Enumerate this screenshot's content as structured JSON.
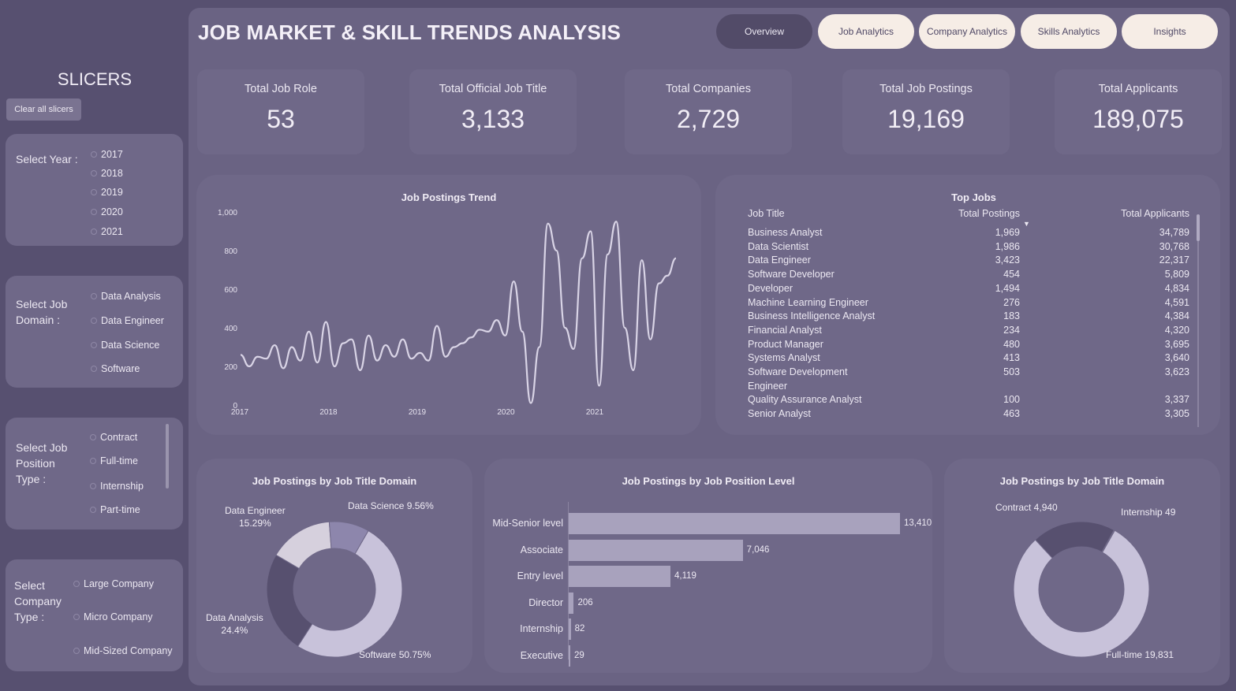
{
  "sidebar": {
    "title": "SLICERS",
    "clear_label": "Clear all slicers",
    "year": {
      "label": "Select Year :",
      "options": [
        "2017",
        "2018",
        "2019",
        "2020",
        "2021"
      ]
    },
    "domain": {
      "label": "Select Job Domain :",
      "options": [
        "Data Analysis",
        "Data Engineer",
        "Data Science",
        "Software"
      ]
    },
    "position": {
      "label": "Select Job Position Type :",
      "options": [
        "Contract",
        "Full-time",
        "Internship",
        "Part-time"
      ]
    },
    "company": {
      "label": "Select Company Type :",
      "options": [
        "Large Company",
        "Micro Company",
        "Mid-Sized Company"
      ]
    }
  },
  "header": {
    "title": "JOB MARKET & SKILL TRENDS ANALYSIS",
    "nav": [
      "Overview",
      "Job Analytics",
      "Company Analytics",
      "Skills Analytics",
      "Insights"
    ],
    "active": "Overview"
  },
  "kpis": [
    {
      "label": "Total Job Role",
      "value": "53"
    },
    {
      "label": "Total Official Job Title",
      "value": "3,133"
    },
    {
      "label": "Total Companies",
      "value": "2,729"
    },
    {
      "label": "Total Job Postings",
      "value": "19,169"
    },
    {
      "label": "Total Applicants",
      "value": "189,075"
    }
  ],
  "top_jobs": {
    "title": "Top Jobs",
    "headers": [
      "Job Title",
      "Total Postings",
      "Total Applicants"
    ],
    "rows": [
      [
        "Business Analyst",
        "1,969",
        "34,789"
      ],
      [
        "Data Scientist",
        "1,986",
        "30,768"
      ],
      [
        "Data Engineer",
        "3,423",
        "22,317"
      ],
      [
        "Software Developer",
        "454",
        "5,809"
      ],
      [
        "Developer",
        "1,494",
        "4,834"
      ],
      [
        "Machine Learning Engineer",
        "276",
        "4,591"
      ],
      [
        "Business Intelligence Analyst",
        "183",
        "4,384"
      ],
      [
        "Financial Analyst",
        "234",
        "4,320"
      ],
      [
        "Product Manager",
        "480",
        "3,695"
      ],
      [
        "Systems Analyst",
        "413",
        "3,640"
      ],
      [
        "Software Development",
        "503",
        "3,623"
      ],
      [
        "Engineer",
        "",
        ""
      ],
      [
        "Quality Assurance Analyst",
        "100",
        "3,337"
      ],
      [
        "Senior Analyst",
        "463",
        "3,305"
      ]
    ]
  },
  "colors": {
    "accent": "#c5bfd7",
    "bar": "#a8a2bd",
    "dark": "#524b68"
  },
  "chart_data": [
    {
      "type": "line",
      "title": "Job Postings Trend",
      "ylim": [
        0,
        1000
      ],
      "yticks": [
        "1,000",
        "800",
        "600",
        "400",
        "200",
        "0"
      ],
      "xticks": [
        "2017",
        "2018",
        "2019",
        "2020",
        "2021"
      ],
      "x": [
        0,
        1,
        2,
        3,
        4,
        5,
        6,
        7,
        8,
        9,
        10,
        11,
        12,
        13,
        14,
        15,
        16,
        17,
        18,
        19,
        20,
        21,
        22,
        23,
        24,
        25,
        26,
        27,
        28,
        29,
        30,
        31,
        32,
        33,
        34,
        35,
        36,
        37,
        38,
        39,
        40,
        41,
        42,
        43,
        44,
        45,
        46,
        47,
        48,
        49
      ],
      "values": [
        260,
        200,
        250,
        240,
        310,
        190,
        300,
        230,
        380,
        220,
        430,
        200,
        320,
        340,
        180,
        360,
        230,
        310,
        250,
        340,
        240,
        270,
        230,
        410,
        250,
        300,
        320,
        350,
        390,
        380,
        440,
        360,
        640,
        380,
        10,
        300,
        940,
        800,
        400,
        290,
        760,
        900,
        100,
        780,
        950,
        400,
        180,
        750,
        340,
        630,
        670,
        760
      ]
    },
    {
      "type": "pie",
      "title": "Job Postings by Job Title Domain",
      "labels": [
        "Software",
        "Data Analysis",
        "Data Engineer",
        "Data Science"
      ],
      "values": [
        50.75,
        24.4,
        15.29,
        9.56
      ],
      "label_text": [
        "Software 50.75%",
        "Data Analysis\n24.4%",
        "Data Engineer\n15.29%",
        "Data Science 9.56%"
      ]
    },
    {
      "type": "bar",
      "title": "Job Postings by Job Position Level",
      "categories": [
        "Mid-Senior level",
        "Associate",
        "Entry level",
        "Director",
        "Internship",
        "Executive"
      ],
      "values": [
        13410,
        7046,
        4119,
        206,
        82,
        29
      ],
      "value_labels": [
        "13,410",
        "7,046",
        "4,119",
        "206",
        "82",
        "29"
      ]
    },
    {
      "type": "pie",
      "title": "Job Postings by Job Title Domain",
      "labels": [
        "Full-time",
        "Contract",
        "Internship"
      ],
      "values": [
        19831,
        4940,
        49
      ],
      "label_text": [
        "Full-time 19,831",
        "Contract 4,940",
        "Internship 49"
      ]
    }
  ]
}
